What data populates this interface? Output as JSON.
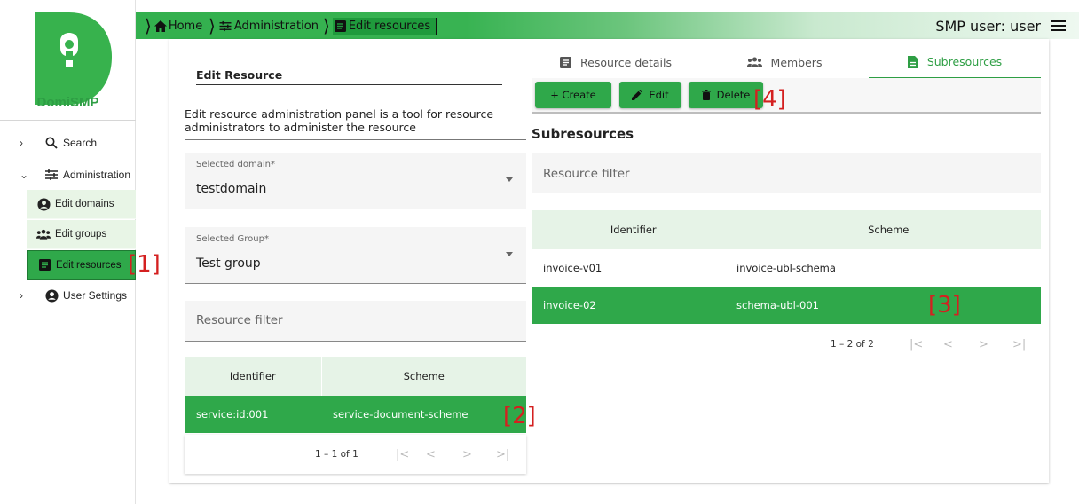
{
  "app": {
    "logo_text": "DomiSMP"
  },
  "sidebar": {
    "items": [
      {
        "label": "Search",
        "icon": "search-icon",
        "expanded": false
      },
      {
        "label": "Administration",
        "icon": "tune-icon",
        "expanded": true
      },
      {
        "label": "User Settings",
        "icon": "account-circle-icon",
        "expanded": false
      }
    ],
    "sub_items": [
      {
        "label": "Edit domains",
        "icon": "account-circle-icon"
      },
      {
        "label": "Edit groups",
        "icon": "group-icon"
      },
      {
        "label": "Edit resources",
        "icon": "document-icon",
        "active": true
      }
    ]
  },
  "breadcrumb": [
    {
      "label": "Home",
      "icon": "home-icon"
    },
    {
      "label": "Administration",
      "icon": "tune-icon"
    },
    {
      "label": "Edit resources",
      "icon": "document-icon"
    }
  ],
  "header": {
    "user_label": "SMP user: user",
    "menu_icon": "hamburger-menu-icon"
  },
  "left_panel": {
    "title": "Edit Resource",
    "description": "Edit resource administration panel is a tool for resource administrators to administer the resource",
    "domain_select": {
      "label": "Selected domain*",
      "value": "testdomain"
    },
    "group_select": {
      "label": "Selected Group*",
      "value": "Test group"
    },
    "filter_placeholder": "Resource filter",
    "table": {
      "columns": [
        "Identifier",
        "Scheme"
      ],
      "rows": [
        [
          "service:id:001",
          "service-document-scheme"
        ]
      ]
    },
    "pager": "1 – 1 of 1"
  },
  "right_panel": {
    "tabs": [
      {
        "label": "Resource details",
        "icon": "document-icon"
      },
      {
        "label": "Members",
        "icon": "group-icon"
      },
      {
        "label": "Subresources",
        "icon": "file-icon",
        "active": true
      }
    ],
    "buttons": {
      "create": "+ Create",
      "edit": "Edit",
      "delete": "Delete"
    },
    "title": "Subresources",
    "filter_placeholder": "Resource filter",
    "table": {
      "columns": [
        "Identifier",
        "Scheme"
      ],
      "rows": [
        [
          "invoice-v01",
          "invoice-ubl-schema"
        ],
        [
          "invoice-02",
          "schema-ubl-001"
        ]
      ],
      "selected_row": 1
    },
    "pager": "1 – 2 of 2"
  },
  "markers": [
    "[1]",
    "[2]",
    "[3]",
    "[4]"
  ],
  "colors": {
    "primary_green": "#2fa84a",
    "accent_text_green": "#2e9e44",
    "marker_red": "#d42020",
    "header_row_bg": "#e6f3e7"
  },
  "pager_icons": [
    "first-page-icon",
    "previous-page-icon",
    "next-page-icon",
    "last-page-icon"
  ]
}
